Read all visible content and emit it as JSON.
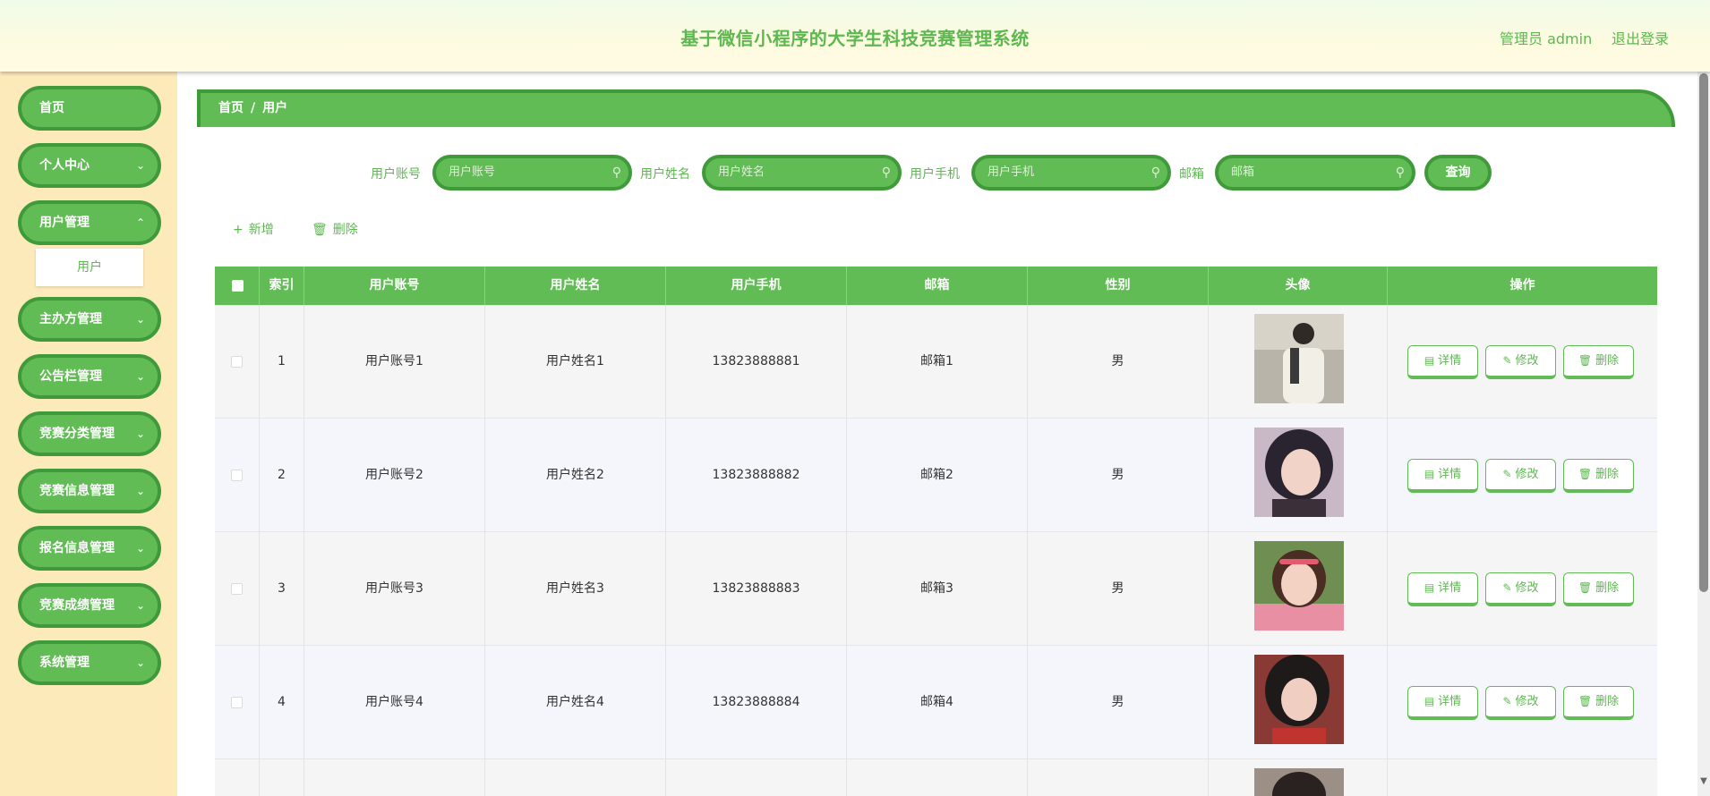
{
  "header": {
    "title": "基于微信小程序的大学生科技竞赛管理系统",
    "admin": "管理员 admin",
    "logout": "退出登录"
  },
  "sidebar": {
    "items": [
      {
        "label": "首页",
        "chevron": false
      },
      {
        "label": "个人中心",
        "chevron": true
      },
      {
        "label": "用户管理",
        "chevron": true
      },
      {
        "label": "主办方管理",
        "chevron": true
      },
      {
        "label": "公告栏管理",
        "chevron": true
      },
      {
        "label": "竞赛分类管理",
        "chevron": true
      },
      {
        "label": "竞赛信息管理",
        "chevron": true
      },
      {
        "label": "报名信息管理",
        "chevron": true
      },
      {
        "label": "竞赛成绩管理",
        "chevron": true
      },
      {
        "label": "系统管理",
        "chevron": true
      }
    ],
    "submenu": "用户"
  },
  "breadcrumb": {
    "home": "首页",
    "sep": "/",
    "current": "用户"
  },
  "search": {
    "fields": [
      {
        "label": "用户账号",
        "placeholder": "用户账号"
      },
      {
        "label": "用户姓名",
        "placeholder": "用户姓名"
      },
      {
        "label": "用户手机",
        "placeholder": "用户手机"
      },
      {
        "label": "邮箱",
        "placeholder": "邮箱"
      }
    ],
    "button": "查询"
  },
  "actions": {
    "add": "新增",
    "delete": "删除"
  },
  "table": {
    "headers": [
      "",
      "索引",
      "用户账号",
      "用户姓名",
      "用户手机",
      "邮箱",
      "性别",
      "头像",
      "操作"
    ],
    "rows": [
      {
        "index": "1",
        "account": "用户账号1",
        "name": "用户姓名1",
        "phone": "13823888881",
        "email": "邮箱1",
        "gender": "男"
      },
      {
        "index": "2",
        "account": "用户账号2",
        "name": "用户姓名2",
        "phone": "13823888882",
        "email": "邮箱2",
        "gender": "男"
      },
      {
        "index": "3",
        "account": "用户账号3",
        "name": "用户姓名3",
        "phone": "13823888883",
        "email": "邮箱3",
        "gender": "男"
      },
      {
        "index": "4",
        "account": "用户账号4",
        "name": "用户姓名4",
        "phone": "13823888884",
        "email": "邮箱4",
        "gender": "男"
      }
    ],
    "ops": {
      "detail": "详情",
      "edit": "修改",
      "delete": "删除"
    }
  },
  "colors": {
    "primary": "#62bc55",
    "primary_dark": "#3f9a3a",
    "sidebar_bg": "#fdeabb",
    "text_green": "#5cb84f"
  }
}
